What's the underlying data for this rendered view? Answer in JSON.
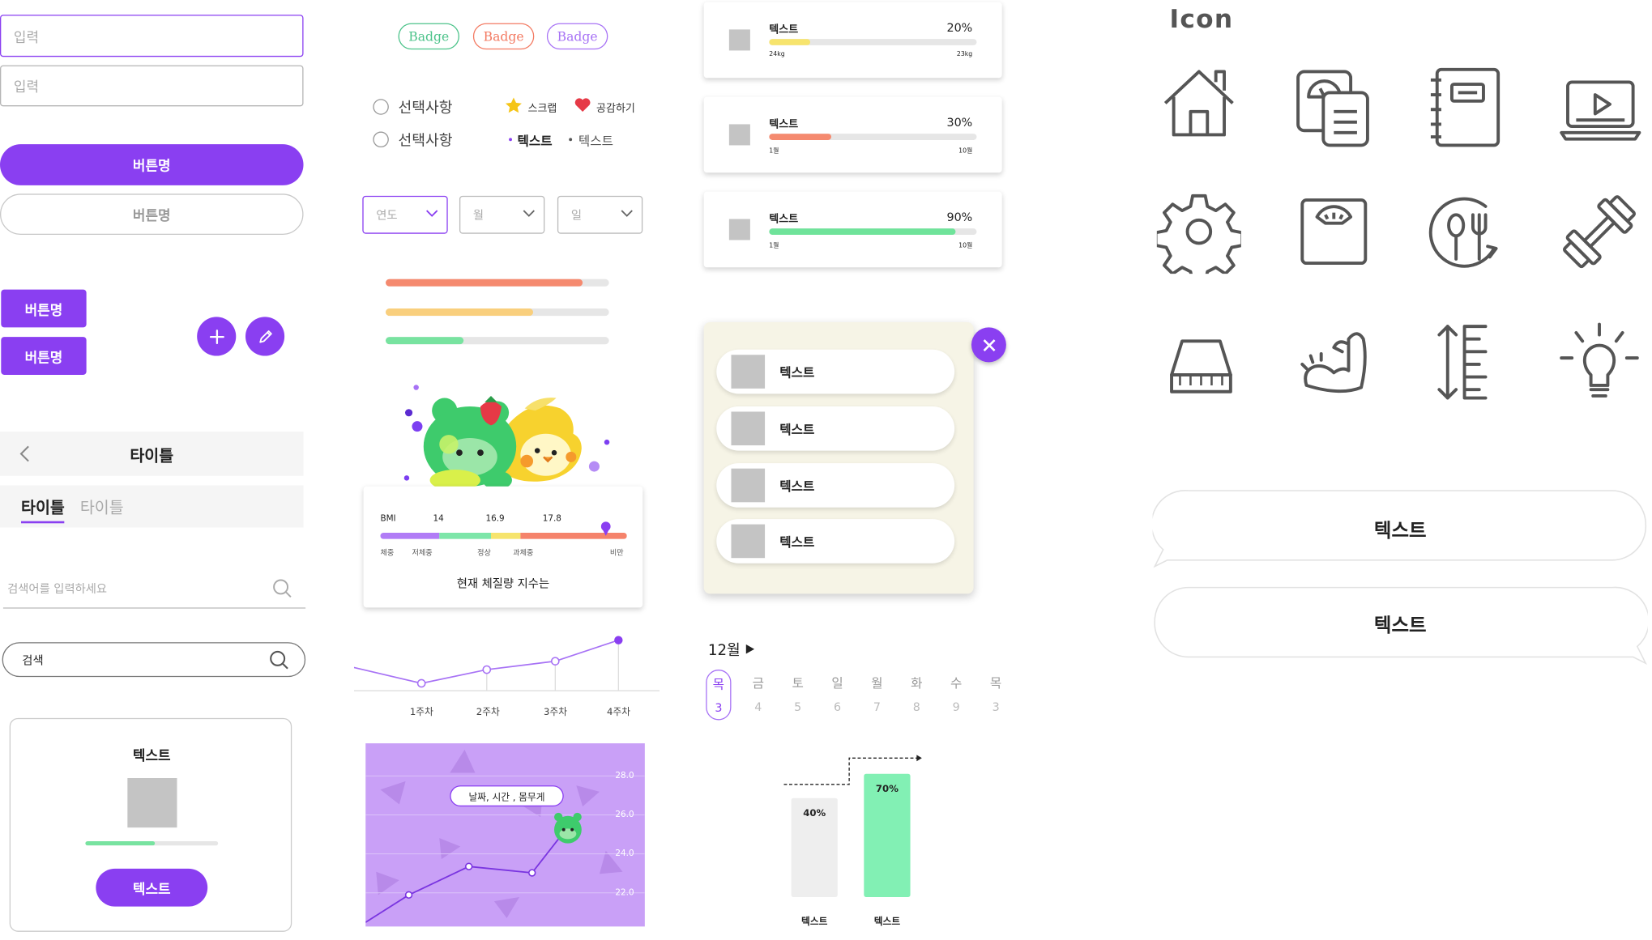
{
  "inputs": {
    "input1_placeholder": "입력",
    "input2_placeholder": "입력"
  },
  "buttons": {
    "primary_pill": "버튼명",
    "outline_pill": "버튼명",
    "square1": "버튼명",
    "square2": "버튼명"
  },
  "header": {
    "title": "타이틀"
  },
  "tabs": [
    {
      "label": "타이틀",
      "active": true
    },
    {
      "label": "타이틀",
      "active": false
    }
  ],
  "search1": {
    "placeholder": "검색어를 입력하세요"
  },
  "search2": {
    "value": "검색"
  },
  "product_card": {
    "title": "텍스트",
    "progress": 0.52,
    "button": "텍스트"
  },
  "badges": [
    {
      "label": "Badge",
      "color": "#4cc38a"
    },
    {
      "label": "Badge",
      "color": "#f37a62"
    },
    {
      "label": "Badge",
      "color": "#a772f5"
    }
  ],
  "radios": [
    "선택사항",
    "선택사항"
  ],
  "actions": {
    "scrap": "스크랩",
    "like": "공감하기"
  },
  "bullets": [
    "텍스트",
    "텍스트"
  ],
  "selects": [
    "연도",
    "월",
    "일"
  ],
  "progress_bars": [
    {
      "value": 0.88,
      "color": "#f58a6f"
    },
    {
      "value": 0.66,
      "color": "#f9cf7d"
    },
    {
      "value": 0.35,
      "color": "#78e3a0"
    }
  ],
  "bmi": {
    "label": "BMI",
    "thresholds": [
      "14",
      "16.9",
      "17.8"
    ],
    "zones": [
      "체중",
      "저체중",
      "정상",
      "과체중",
      "비만"
    ],
    "caption": "현재 체질량 지수는"
  },
  "line_chart": {
    "categories": [
      "1주차",
      "2주차",
      "3주차",
      "4주차"
    ]
  },
  "purple_chart": {
    "tooltip": "날짜, 시간 , 몸무게",
    "y_ticks": [
      "28.0",
      "26.0",
      "24.0",
      "22.0"
    ]
  },
  "stat_cards": [
    {
      "label": "텍스트",
      "percent": "20%",
      "value": 0.2,
      "color": "#f7e46d",
      "min": "24kg",
      "max": "23kg"
    },
    {
      "label": "텍스트",
      "percent": "30%",
      "value": 0.3,
      "color": "#f58a6f",
      "min": "1월",
      "max": "10월"
    },
    {
      "label": "텍스트",
      "percent": "90%",
      "value": 0.9,
      "color": "#6fe39a",
      "min": "1월",
      "max": "10월"
    }
  ],
  "popup_list": [
    "텍스트",
    "텍스트",
    "텍스트",
    "텍스트"
  ],
  "calendar": {
    "month": "12월",
    "days": [
      {
        "weekday": "목",
        "date": "3",
        "selected": true
      },
      {
        "weekday": "금",
        "date": "4"
      },
      {
        "weekday": "토",
        "date": "5"
      },
      {
        "weekday": "일",
        "date": "6"
      },
      {
        "weekday": "월",
        "date": "7"
      },
      {
        "weekday": "화",
        "date": "8"
      },
      {
        "weekday": "수",
        "date": "9"
      },
      {
        "weekday": "목",
        "date": "3"
      }
    ]
  },
  "compare_bars": [
    {
      "percent": "40%",
      "label": "텍스트",
      "color": "#eeeeee"
    },
    {
      "percent": "70%",
      "label": "텍스트",
      "color": "#82f0b4"
    }
  ],
  "icons": {
    "title": "Icon",
    "names": [
      "home-icon",
      "scale-report-icon",
      "notebook-icon",
      "video-laptop-icon",
      "gear-icon",
      "weight-scale-icon",
      "meal-timer-icon",
      "dumbbell-icon",
      "body-fat-scale-icon",
      "muscle-arm-icon",
      "height-ruler-icon",
      "lightbulb-icon"
    ]
  },
  "speech_bubbles": [
    "텍스트",
    "텍스트"
  ],
  "colors": {
    "primary": "#8a3ff1",
    "popup_bg": "#f6f4e6"
  }
}
